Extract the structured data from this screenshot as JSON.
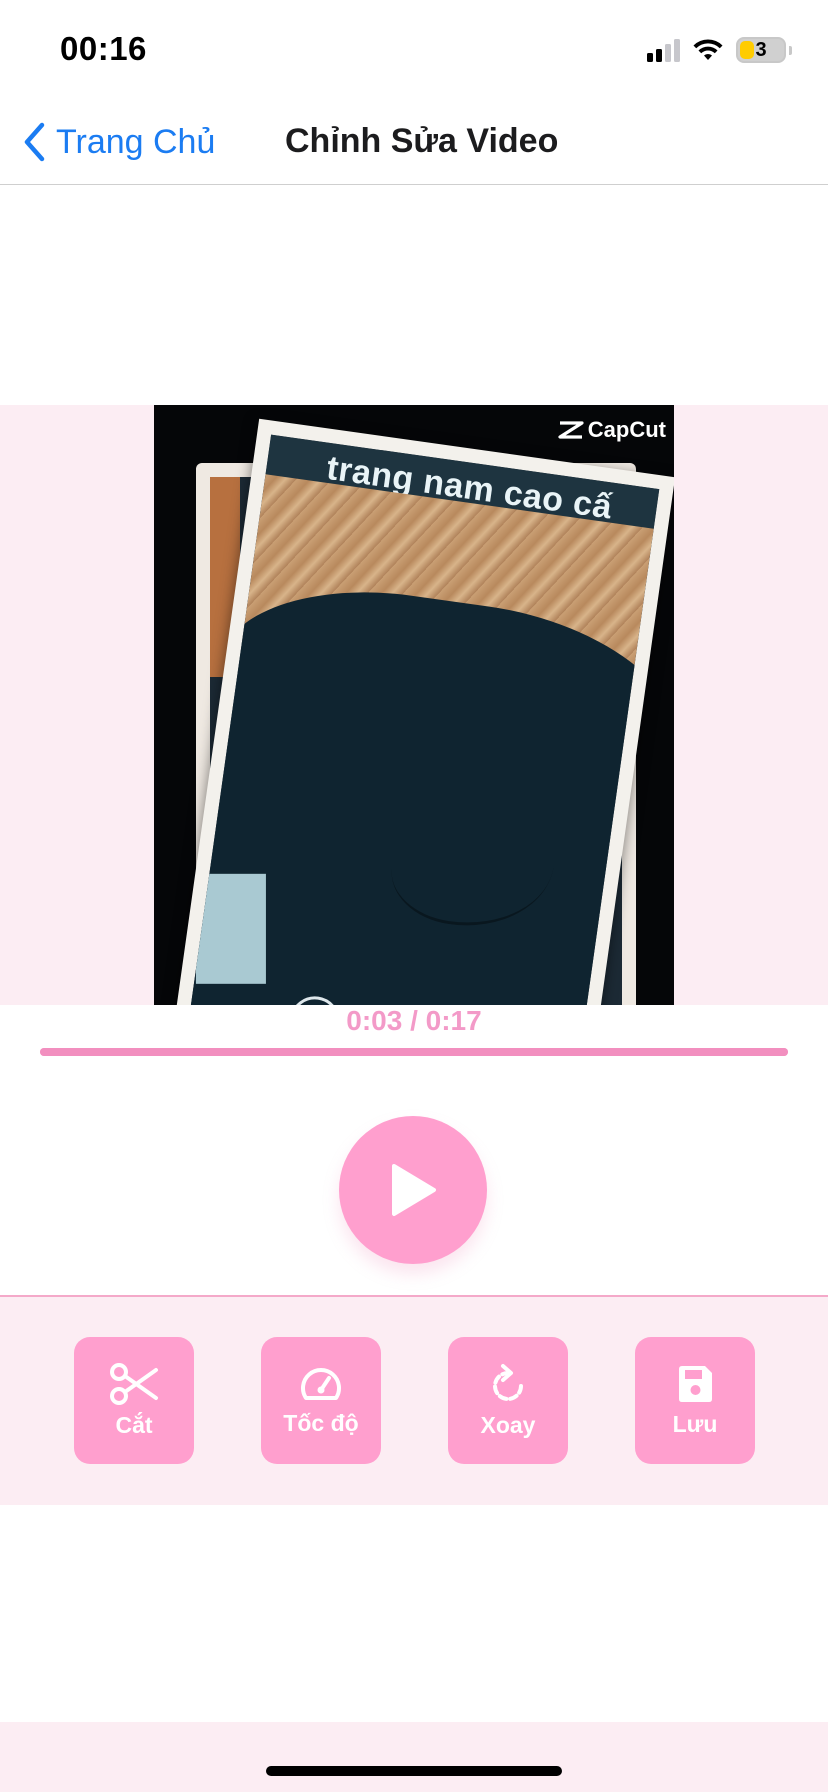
{
  "status_bar": {
    "time": "00:16",
    "battery_level": "3",
    "cellular_bars": 2,
    "wifi": true
  },
  "nav": {
    "back_label": "Trang Chủ",
    "title": "Chỉnh Sửa Video",
    "accent_color": "#1b7cf2"
  },
  "video": {
    "watermark": "CapCut",
    "overlay_text": "trang nam cao cấ",
    "current_time": "0:03",
    "duration": "0:17",
    "time_display": "0:03 / 0:17",
    "progress_fraction": 1.0
  },
  "controls": {
    "play_icon": "play-icon"
  },
  "tools": [
    {
      "label": "Cắt",
      "icon": "scissors-icon"
    },
    {
      "label": "Tốc độ",
      "icon": "speedometer-icon"
    },
    {
      "label": "Xoay",
      "icon": "rotate-icon"
    },
    {
      "label": "Lưu",
      "icon": "save-icon"
    }
  ],
  "colors": {
    "primary_pink": "#ff9fce",
    "pink_background": "#fcedf3",
    "time_text": "#f39ac8"
  }
}
